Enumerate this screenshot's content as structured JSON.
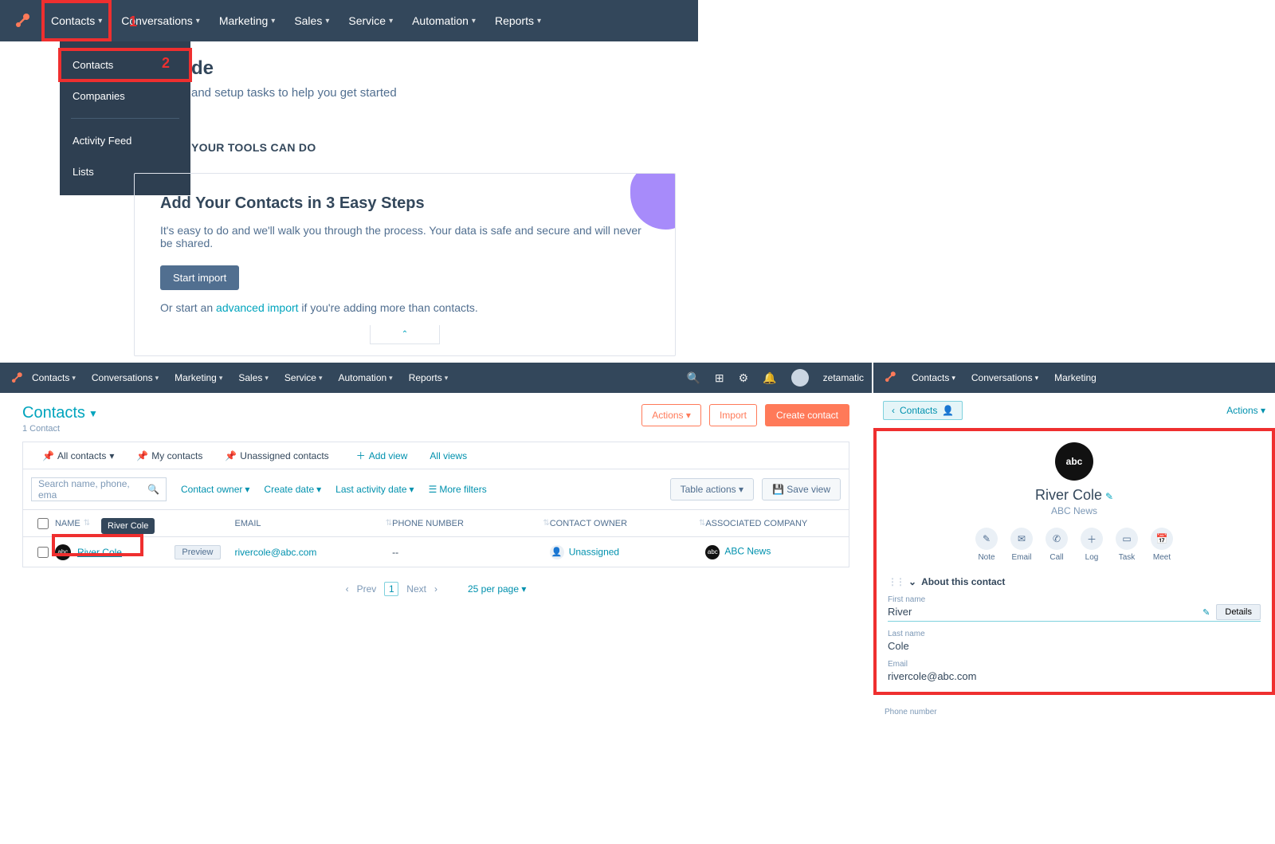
{
  "region1": {
    "nav": {
      "items": [
        "Contacts",
        "Conversations",
        "Marketing",
        "Sales",
        "Service",
        "Automation",
        "Reports"
      ]
    },
    "dropdown": {
      "items": [
        "Contacts",
        "Companies",
        "Activity Feed",
        "Lists"
      ]
    },
    "annotations": {
      "step1": "1",
      "step2": "2"
    },
    "page": {
      "title_fragment": "de",
      "subtitle_fragment": "and setup tasks to help you get started",
      "section_header_fragment": "YOUR TOOLS CAN DO"
    },
    "card": {
      "title": "Add Your Contacts in 3 Easy Steps",
      "body": "It's easy to do and we'll walk you through the process. Your data is safe and secure and will never be shared.",
      "button": "Start import",
      "or_prefix": "Or start an ",
      "or_link": "advanced import",
      "or_suffix": " if you're adding more than contacts."
    }
  },
  "region2": {
    "nav": {
      "items": [
        "Contacts",
        "Conversations",
        "Marketing",
        "Sales",
        "Service",
        "Automation",
        "Reports"
      ],
      "user": "zetamatic"
    },
    "header": {
      "title": "Contacts",
      "count": "1 Contact",
      "buttons": {
        "actions": "Actions",
        "import": "Import",
        "create": "Create contact"
      }
    },
    "tabs": {
      "items": [
        "All contacts",
        "My contacts",
        "Unassigned contacts"
      ],
      "add": "Add view",
      "all": "All views"
    },
    "filters": {
      "search_placeholder": "Search name, phone, ema",
      "owner": "Contact owner",
      "create": "Create date",
      "activity": "Last activity date",
      "more": "More filters",
      "table_actions": "Table actions",
      "save_view": "Save view"
    },
    "columns": [
      "NAME",
      "EMAIL",
      "PHONE NUMBER",
      "CONTACT OWNER",
      "ASSOCIATED COMPANY"
    ],
    "tooltip": "River Cole",
    "rows": [
      {
        "avatar": "abc",
        "name": "River Cole",
        "preview": "Preview",
        "email": "rivercole@abc.com",
        "phone": "--",
        "owner": "Unassigned",
        "company_avatar": "abc",
        "company": "ABC News"
      }
    ],
    "pager": {
      "prev": "Prev",
      "page": "1",
      "next": "Next",
      "perpage": "25 per page"
    }
  },
  "region3": {
    "nav": {
      "items": [
        "Contacts",
        "Conversations",
        "Marketing"
      ]
    },
    "subheader": {
      "back": "Contacts",
      "actions": "Actions"
    },
    "contact": {
      "avatar": "abc",
      "name": "River Cole",
      "subtitle": "ABC News"
    },
    "actions": [
      {
        "icon": "✎",
        "label": "Note"
      },
      {
        "icon": "✉",
        "label": "Email"
      },
      {
        "icon": "✆",
        "label": "Call"
      },
      {
        "icon": "＋",
        "label": "Log"
      },
      {
        "icon": "▭",
        "label": "Task"
      },
      {
        "icon": "📅",
        "label": "Meet"
      }
    ],
    "about": {
      "title": "About this contact",
      "details_btn": "Details",
      "fields": [
        {
          "label": "First name",
          "value": "River",
          "editable": true
        },
        {
          "label": "Last name",
          "value": "Cole"
        },
        {
          "label": "Email",
          "value": "rivercole@abc.com"
        }
      ],
      "cutoff": "Phone number"
    }
  }
}
